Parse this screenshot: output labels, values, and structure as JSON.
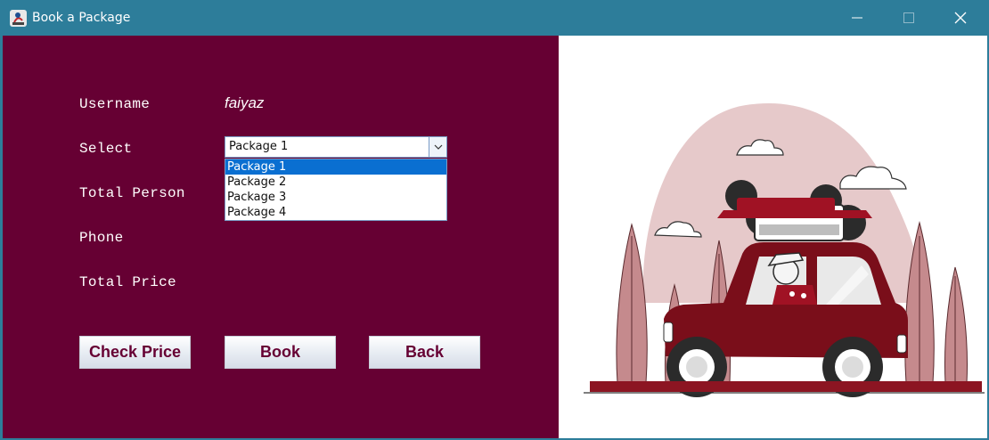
{
  "window": {
    "title": "Book a Package",
    "controls": [
      "minimize-icon",
      "maximize-icon",
      "close-icon"
    ]
  },
  "form": {
    "username_label": "Username",
    "username_value": "faiyaz",
    "select_label": "Select",
    "select_value": "Package 1",
    "package_options": [
      "Package 1",
      "Package 2",
      "Package 3",
      "Package 4"
    ],
    "selected_option_index": 0,
    "total_person_label": "Total Person",
    "phone_label": "Phone",
    "total_price_label": "Total Price"
  },
  "buttons": {
    "check_price": "Check Price",
    "book": "Book",
    "back": "Back"
  },
  "colors": {
    "titlebar": "#2d7d9a",
    "panel_bg": "#660033",
    "accent_selection": "#0a6fd1",
    "illustration_red": "#7a0e1a"
  }
}
